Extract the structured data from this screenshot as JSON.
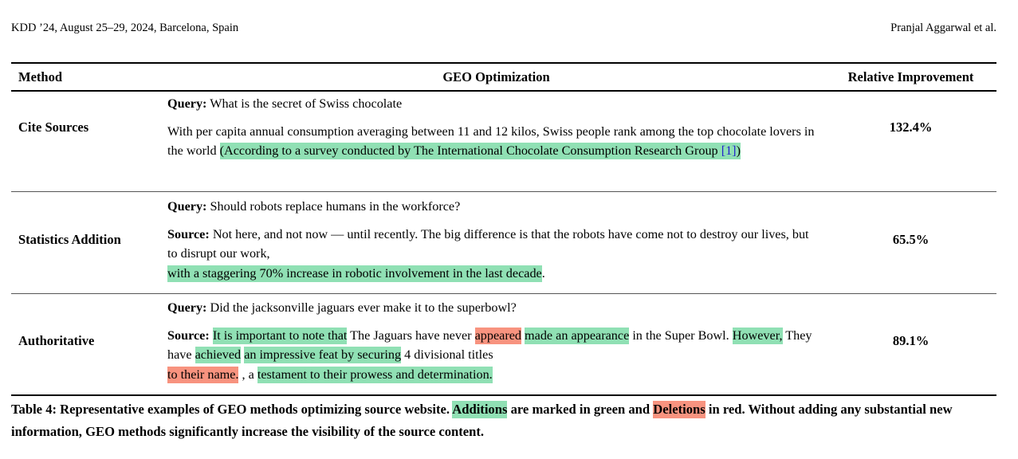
{
  "runhead": {
    "left": "KDD ’24, August 25–29, 2024, Barcelona, Spain",
    "right": "Pranjal Aggarwal et al."
  },
  "table": {
    "headers": {
      "method": "Method",
      "geo": "GEO Optimization",
      "relative": "Relative Improvement"
    },
    "labels": {
      "query": "Query:",
      "source": "Source:"
    },
    "rows": [
      {
        "method": "Cite Sources",
        "query": " What is the secret of Swiss chocolate",
        "body_pre": "With per capita annual consumption averaging between 11 and 12 kilos, Swiss people rank among the top chocolate lovers in the world ",
        "body_add_1": "(According to a survey conducted by The International Chocolate Consumption Research Group ",
        "body_cite": "[1]",
        "body_add_2": ")",
        "relative": "132.4%"
      },
      {
        "method": "Statistics Addition",
        "query": " Should robots replace humans in the workforce?",
        "source_pre": " Not here, and not now — until recently. The big difference is that the robots have come not to destroy our lives, but to disrupt our work,",
        "source_add": "with a staggering 70% increase in robotic involvement in the last decade",
        "source_post": ".",
        "relative": "65.5%"
      },
      {
        "method": "Authoritative",
        "query": " Did the jacksonville jaguars ever make it to the superbowl?",
        "seg_add_1": "It is important to note that",
        "seg_plain_1": " The Jaguars have never ",
        "seg_del_1": "appeared",
        "seg_add_2": "made an appearance",
        "seg_plain_2": " in the Super Bowl. ",
        "seg_add_3": "However,",
        "seg_plain_3": " They have ",
        "seg_add_4": "achieved",
        "seg_add_5": "an impressive feat by securing",
        "seg_plain_4": " 4 divisional titles ",
        "seg_del_2": "to their name.",
        "seg_plain_5": " , a ",
        "seg_add_6": "testament to their prowess and determination.",
        "relative": "89.1%"
      }
    ]
  },
  "caption": {
    "part1": "Table 4:  Representative examples of GEO methods optimizing source website. ",
    "additions": "Additions",
    "part2": " are marked in green and ",
    "deletions": "Deletions",
    "part3": " in red. Without adding any substantial new information, GEO methods significantly increase the visibility of the source content."
  },
  "colors": {
    "addition_green": "#90e0b4",
    "deletion_red": "#f8937f",
    "citation_blue": "#2222cc"
  }
}
